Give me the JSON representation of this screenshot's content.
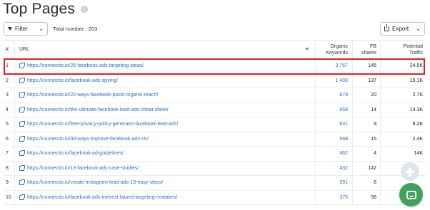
{
  "header": {
    "title": "Top Pages",
    "info_icon": "info-icon"
  },
  "toolbar": {
    "filter_label": "Filter",
    "total_label": "Total number : 203",
    "export_label": "Export"
  },
  "table": {
    "columns": {
      "num": "#",
      "url": "URL",
      "organic_line1": "Organic",
      "organic_line2": "Keywords",
      "fb_line1": "FB",
      "fb_line2": "shares",
      "traffic_line1": "Potential",
      "traffic_line2": "Traffic"
    },
    "rows": [
      {
        "num": "1",
        "url": "https://connectio.io/25-facebook-ads-targeting-ideas/",
        "organic": "3 767",
        "fb": "145",
        "traffic": "24.5K"
      },
      {
        "num": "2",
        "url": "https://connectio.io/facebook-ads-spying/",
        "organic": "1 403",
        "fb": "137",
        "traffic": "15.1K"
      },
      {
        "num": "3",
        "url": "https://connectio.io/20-ways-facebook-posts-organic-reach/",
        "organic": "879",
        "fb": "20",
        "traffic": "2.7K"
      },
      {
        "num": "4",
        "url": "https://connectio.io/the-ultimate-facebook-lead-ads-cheat-sheet/",
        "organic": "668",
        "fb": "14",
        "traffic": "14.3K"
      },
      {
        "num": "5",
        "url": "https://connectio.io/free-privacy-policy-generator-facebook-lead-ads/",
        "organic": "631",
        "fb": "9",
        "traffic": "8.2K"
      },
      {
        "num": "6",
        "url": "https://connectio.io/30-ways-improve-facebook-ads-ctr/",
        "organic": "568",
        "fb": "15",
        "traffic": "2.4K"
      },
      {
        "num": "7",
        "url": "https://connectio.io/facebook-ad-guidelines/",
        "organic": "462",
        "fb": "4",
        "traffic": "14K"
      },
      {
        "num": "8",
        "url": "https://connectio.io/13-facebook-ads-case-studies/",
        "organic": "432",
        "fb": "142",
        "traffic": ""
      },
      {
        "num": "9",
        "url": "https://connectio.io/create-instagram-lead-ads-13-easy-steps/",
        "organic": "391",
        "fb": "6",
        "traffic": ""
      },
      {
        "num": "10",
        "url": "https://connectio.io/facebook-ads-interest-based-targeting-mistakes/",
        "organic": "375",
        "fb": "56",
        "traffic": ""
      }
    ]
  },
  "colors": {
    "link": "#2f6fbf",
    "highlight": "#e02020",
    "chat": "#3ea35a"
  }
}
